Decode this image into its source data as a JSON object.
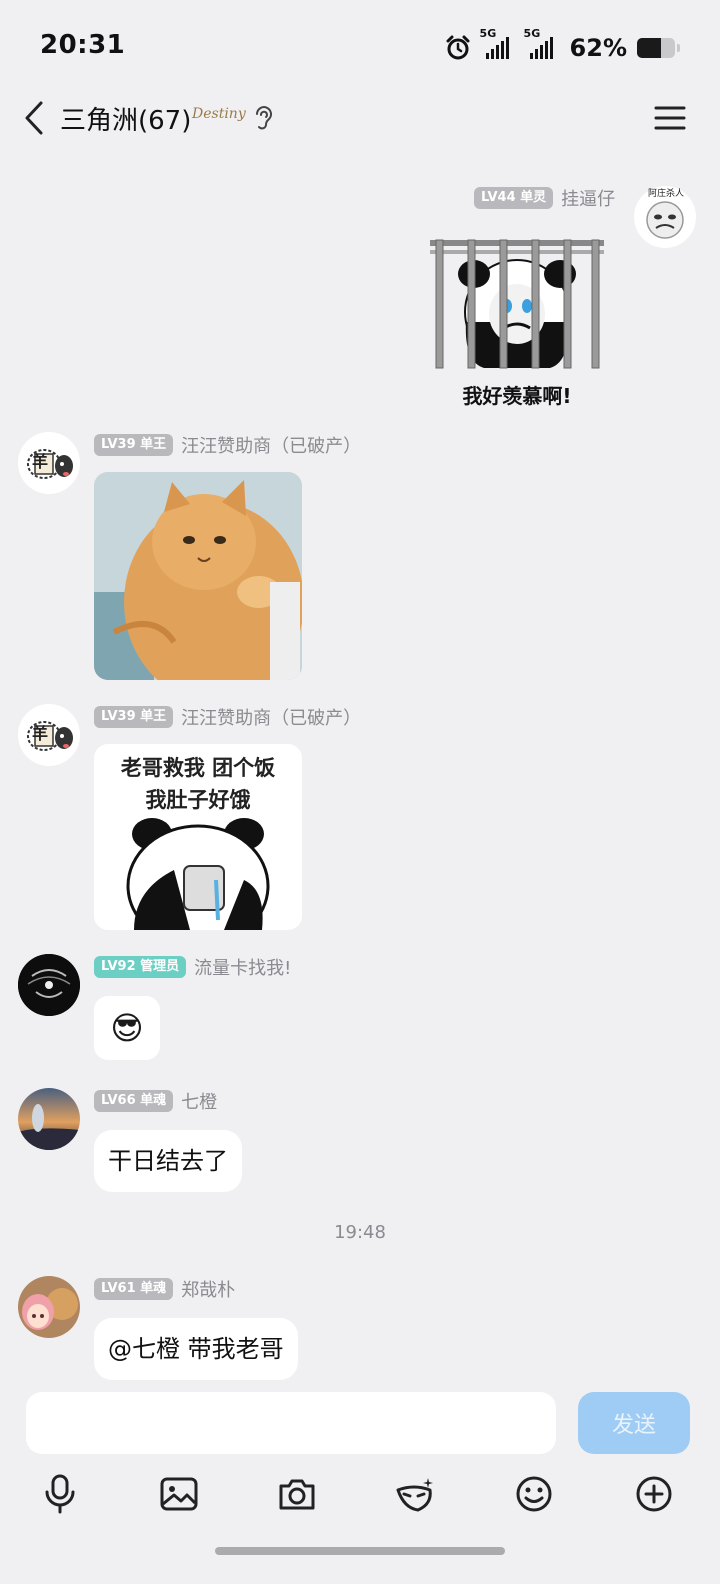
{
  "status_bar": {
    "time": "20:31",
    "network1": "5G",
    "network2": "5G",
    "battery_percent": "62%",
    "battery_level": 0.62,
    "alarm_icon": "alarm-icon"
  },
  "header": {
    "title": "三角洲(67)",
    "logo_text": "Destiny",
    "back_icon": "chevron-left-icon",
    "ear_icon": "ear-icon",
    "menu_icon": "hamburger-menu-icon"
  },
  "messages": [
    {
      "level": "LV44 单灵",
      "nick": "挂逼仔",
      "side": "right",
      "sticker_caption": "我好羡慕啊!",
      "avatar_text": "阿庄杀人"
    },
    {
      "level": "LV39 单王",
      "nick": "汪汪赞助商（已破产）",
      "avatar_text": "羊"
    },
    {
      "level": "LV39 单王",
      "nick": "汪汪赞助商（已破产）",
      "avatar_text": "羊",
      "sticker_line1": "老哥救我 团个饭",
      "sticker_line2": "我肚子好饿"
    },
    {
      "level": "LV92 管理员",
      "nick": "流量卡找我!",
      "emoji": "😎"
    },
    {
      "level": "LV66 单魂",
      "nick": "七橙",
      "text": "干日结去了"
    },
    {
      "level": "LV61 单魂",
      "nick": "郑哉朴",
      "text": "@七橙 带我老哥"
    }
  ],
  "timestamp": "19:48",
  "input": {
    "value": "",
    "placeholder": "",
    "send_label": "发送"
  },
  "toolbar": [
    {
      "icon": "microphone-icon"
    },
    {
      "icon": "image-icon"
    },
    {
      "icon": "camera-icon"
    },
    {
      "icon": "face-mask-icon"
    },
    {
      "icon": "emoji-icon"
    },
    {
      "icon": "plus-icon"
    }
  ],
  "colors": {
    "background": "#f0f0f3",
    "send_button": "#9fccf4",
    "admin_badge": "#6ccfc3",
    "level_badge": "#b8b8bd"
  }
}
